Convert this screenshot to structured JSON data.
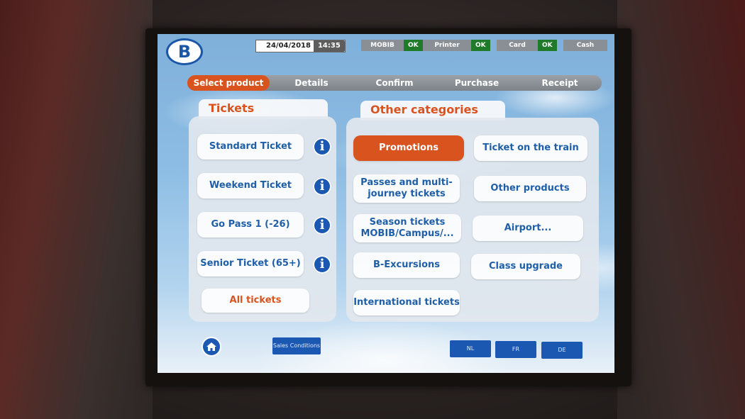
{
  "logo": {
    "text": "B"
  },
  "status": {
    "date": "24/04/2018",
    "time": "14:35",
    "mobib_label": "MOBIB",
    "mobib_state": "OK",
    "printer_label": "Printer",
    "printer_state": "OK",
    "card_label": "Card",
    "card_state": "OK",
    "cash_label": "Cash"
  },
  "tabs": [
    "Select product",
    "Details",
    "Confirm",
    "Purchase",
    "Receipt"
  ],
  "tickets": {
    "heading": "Tickets",
    "items": [
      "Standard Ticket",
      "Weekend Ticket",
      "Go Pass 1 (-26)",
      "Senior Ticket (65+)"
    ],
    "all": "All tickets"
  },
  "other": {
    "heading": "Other categories",
    "items": [
      "Promotions",
      "Ticket on the train",
      "Passes and multi-journey tickets",
      "Other products",
      "Season tickets MOBIB/Campus/...",
      "Airport...",
      "B-Excursions",
      "Class upgrade",
      "International tickets"
    ]
  },
  "footer": {
    "sales_conditions": "Sales Conditions",
    "languages": [
      "NL",
      "FR",
      "DE"
    ]
  },
  "colors": {
    "accent": "#d9531f",
    "brand_blue": "#1b58b2",
    "ok_green": "#1f7a2a"
  },
  "icons": [
    "info-icon",
    "home-icon"
  ]
}
